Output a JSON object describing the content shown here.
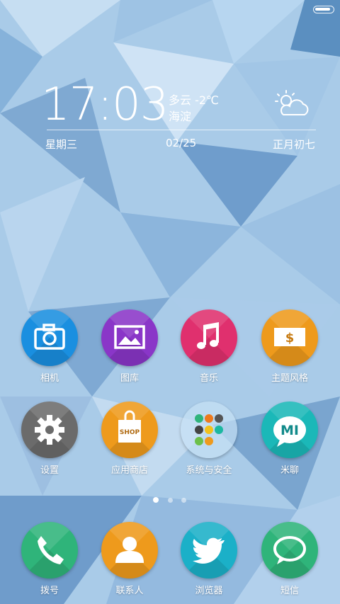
{
  "status_bar": {
    "battery_level": 0.9
  },
  "clock": {
    "time": "17:03",
    "weather": "多云 -2℃",
    "city": "海淀",
    "weekday": "星期三",
    "date": "02/25",
    "lunar_date": "正月初七",
    "weather_icon": "partly-cloudy-icon"
  },
  "apps": [
    {
      "label": "相机",
      "icon": "camera-icon",
      "color": "#1a8fe0"
    },
    {
      "label": "图库",
      "icon": "gallery-icon",
      "color": "#8a36c8"
    },
    {
      "label": "音乐",
      "icon": "music-icon",
      "color": "#e0306e"
    },
    {
      "label": "主题风格",
      "icon": "theme-icon",
      "color": "#ee9a1c"
    },
    {
      "label": "设置",
      "icon": "gear-icon",
      "color": "#6b6b6b"
    },
    {
      "label": "应用商店",
      "icon": "shop-bag-icon",
      "color": "#ee9a1c",
      "badge": "SHOP"
    },
    {
      "label": "系统与安全",
      "icon": "folder-icon",
      "color": "#bcd7ee"
    },
    {
      "label": "米聊",
      "icon": "mi-chat-icon",
      "color": "#1bb8b8",
      "badge": "MI"
    }
  ],
  "page_indicator": {
    "count": 3,
    "active": 0
  },
  "dock": [
    {
      "label": "拨号",
      "icon": "phone-icon",
      "color": "#2fb47a"
    },
    {
      "label": "联系人",
      "icon": "contact-icon",
      "color": "#ee9a1c"
    },
    {
      "label": "浏览器",
      "icon": "twitter-bird-icon",
      "color": "#1bb0c8"
    },
    {
      "label": "短信",
      "icon": "message-icon",
      "color": "#2fb47a"
    }
  ]
}
